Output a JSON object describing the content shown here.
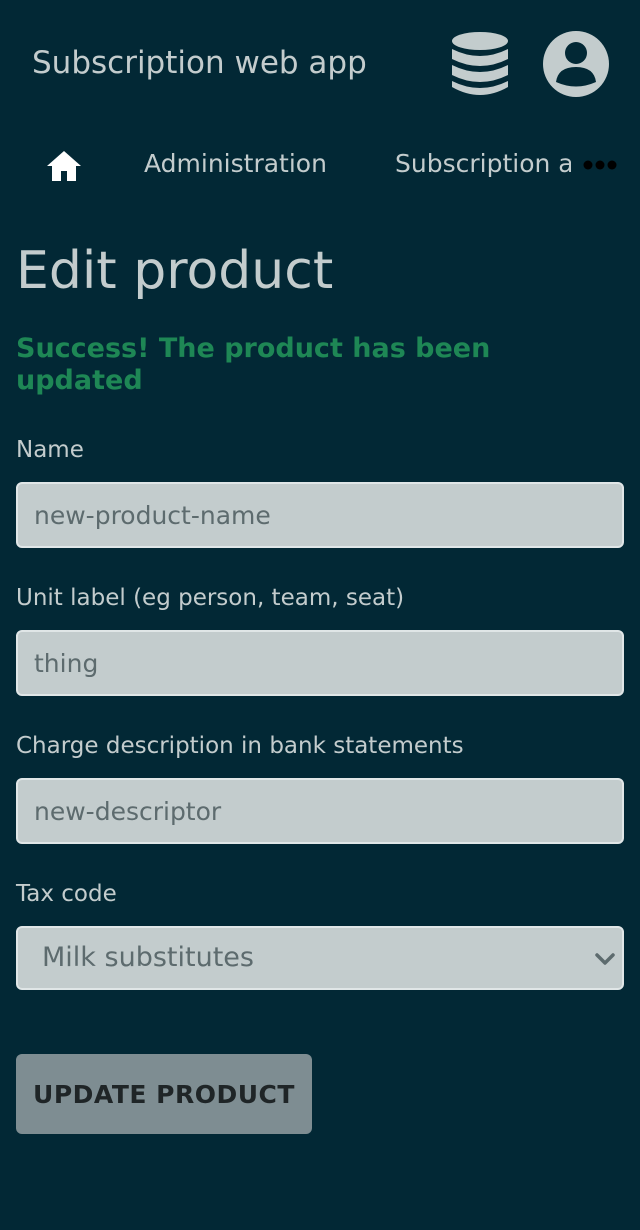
{
  "header": {
    "app_title": "Subscription web app",
    "db_icon": "database-icon",
    "user_icon": "user-account-icon"
  },
  "nav": {
    "home_icon": "home-icon",
    "items": [
      {
        "label": "Administration"
      },
      {
        "label": "Subscription a"
      }
    ],
    "more_icon": "more-horizontal-icon"
  },
  "page": {
    "title": "Edit product",
    "success_message": "Success! The product has been updated"
  },
  "form": {
    "name": {
      "label": "Name",
      "placeholder": "new-product-name",
      "value": ""
    },
    "unit_label": {
      "label": "Unit label (eg person, team, seat)",
      "placeholder": "thing",
      "value": ""
    },
    "descriptor": {
      "label": "Charge description in bank statements",
      "placeholder": "new-descriptor",
      "value": ""
    },
    "tax_code": {
      "label": "Tax code",
      "selected": "Milk substitutes"
    },
    "submit_label": "UPDATE PRODUCT"
  },
  "colors": {
    "background": "#022835",
    "text": "#c3cccd",
    "success": "#1e8755",
    "input_bg": "#c3cccd",
    "button_bg": "#7e8d92"
  }
}
